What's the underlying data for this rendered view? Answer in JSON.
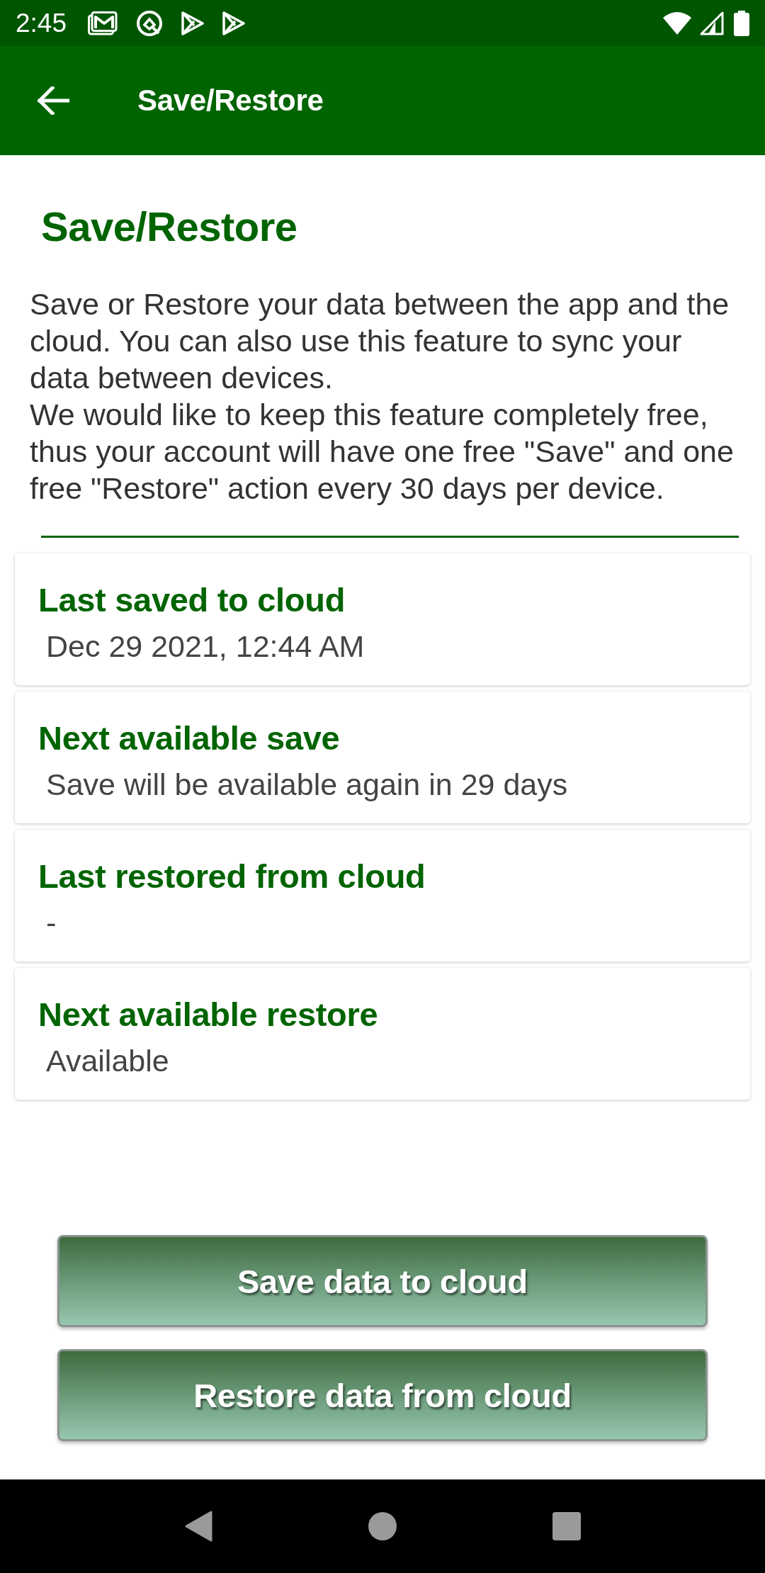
{
  "status_bar": {
    "time": "2:45"
  },
  "app_bar": {
    "title": "Save/Restore"
  },
  "heading": "Save/Restore",
  "description": [
    "Save or Restore your data between the app and the cloud. You can also use this feature to sync your data between devices.",
    "We would like to keep this feature completely free, thus your account will have one free \"Save\" and one free \"Restore\" action every 30 days per device."
  ],
  "info_cards": [
    {
      "title": "Last saved to cloud",
      "value": "Dec 29 2021, 12:44 AM"
    },
    {
      "title": "Next available save",
      "value": "Save will be available again in 29 days"
    },
    {
      "title": "Last restored from cloud",
      "value": "-"
    },
    {
      "title": "Next available restore",
      "value": "Available"
    }
  ],
  "buttons": [
    "Save data to cloud",
    "Restore data from cloud"
  ]
}
